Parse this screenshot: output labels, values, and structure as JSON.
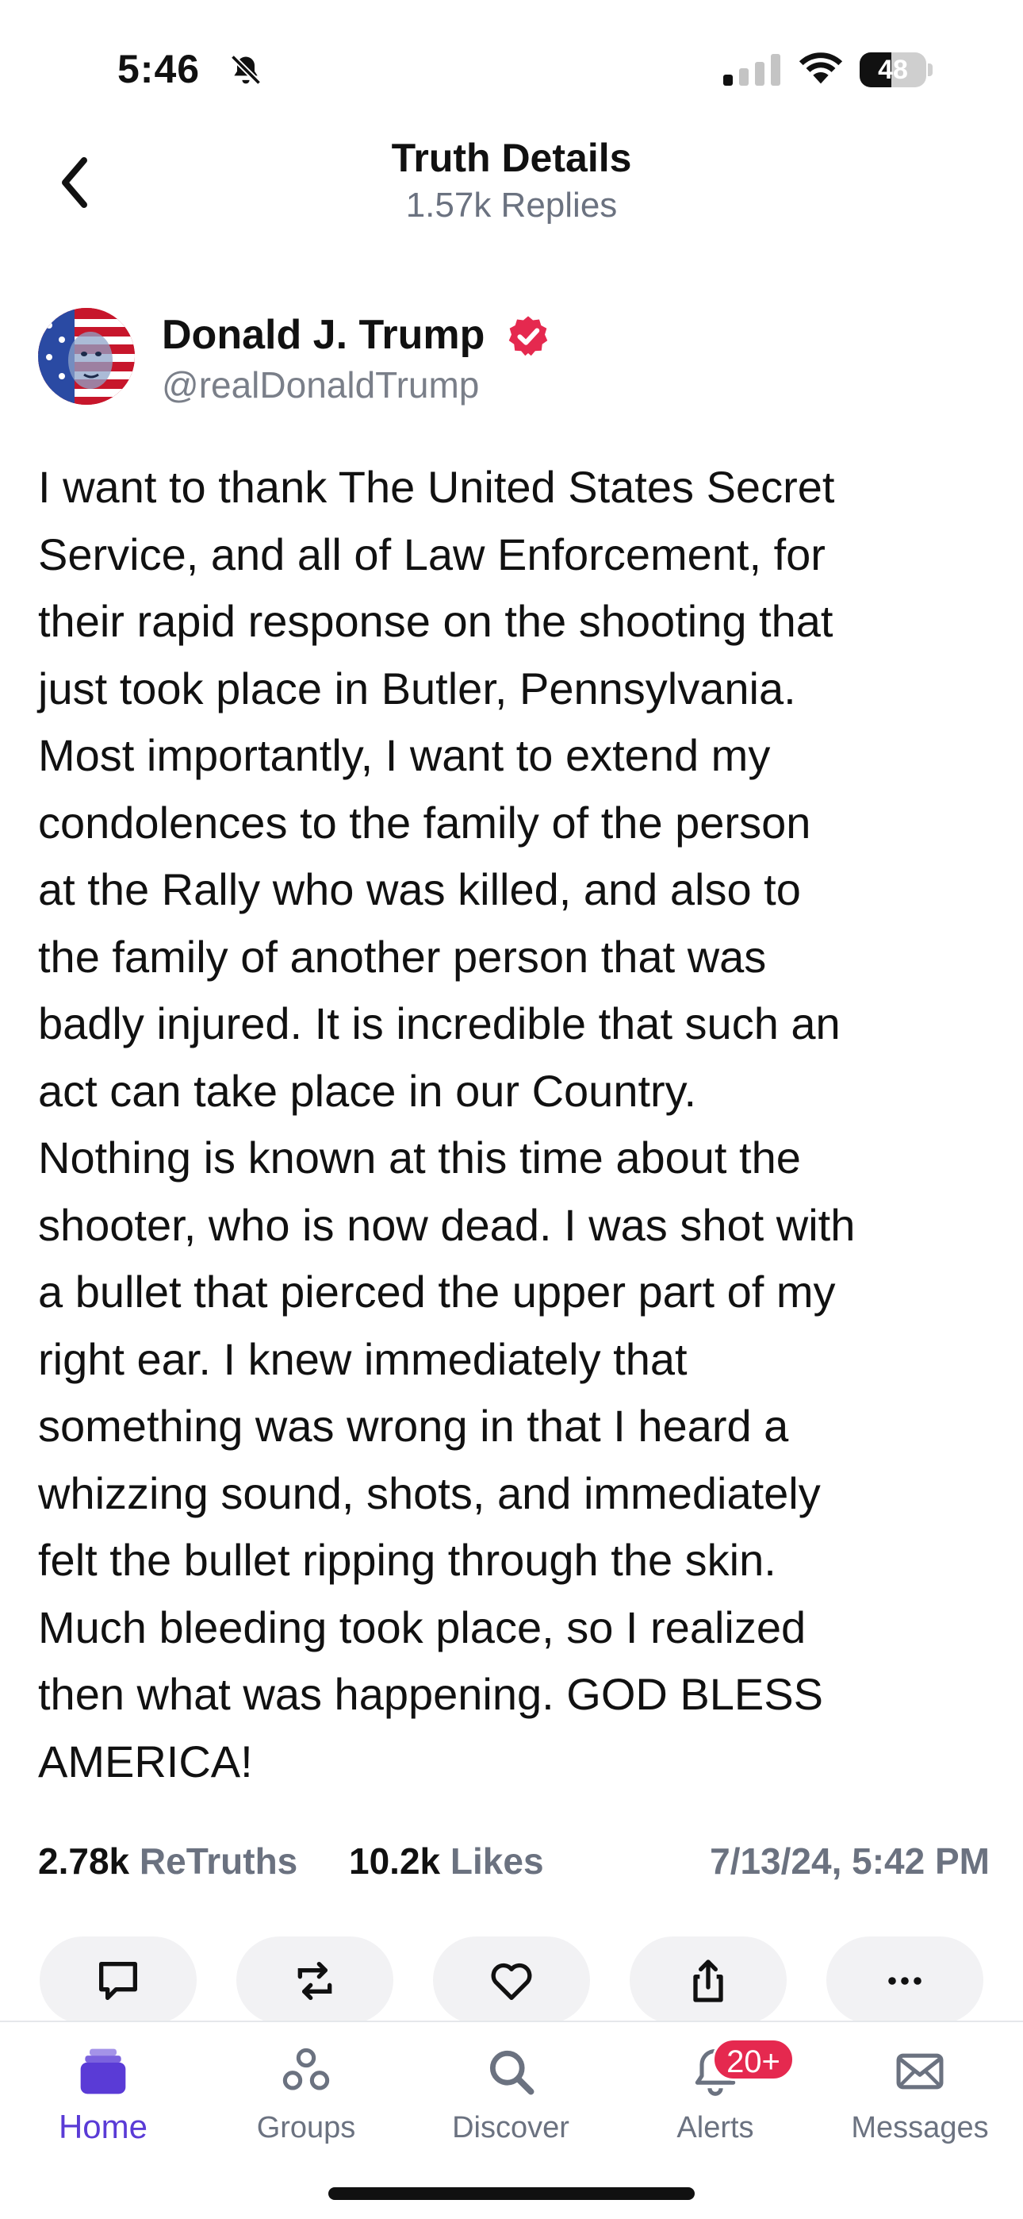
{
  "status_bar": {
    "time": "5:46",
    "battery": "48",
    "battery_level": 0.48,
    "icons": [
      "bell-slash-icon",
      "cellular-signal-icon",
      "wifi-icon",
      "battery-icon"
    ]
  },
  "header": {
    "title": "Truth Details",
    "subtitle": "1.57k Replies",
    "back_icon": "chevron-left-icon"
  },
  "post": {
    "author_name": "Donald J. Trump",
    "author_handle": "@realDonaldTrump",
    "verified_color": "#e5294f",
    "body": "I want to thank The United States Secret\nService, and all of Law Enforcement, for\ntheir rapid response on the shooting that\njust took place in Butler, Pennsylvania.\nMost importantly, I want to extend my\ncondolences to the family of the person\nat the Rally who was killed, and also to\nthe family of another person that was\nbadly injured. It is incredible that such an\nact can take place in our Country.\nNothing is known at this time about the\nshooter, who is now dead. I was shot with\na bullet that pierced the upper part of my\nright ear. I knew immediately that\nsomething was wrong in that I heard a\nwhizzing sound, shots, and immediately\nfelt the bullet ripping through the skin.\nMuch bleeding took place, so I realized\nthen what was happening. GOD BLESS\nAMERICA!",
    "retruths_count": "2.78k",
    "retruths_label": "ReTruths",
    "likes_count": "10.2k",
    "likes_label": "Likes",
    "timestamp": "7/13/24, 5:42 PM"
  },
  "actions": [
    {
      "icon": "reply-icon"
    },
    {
      "icon": "retruth-icon"
    },
    {
      "icon": "heart-icon"
    },
    {
      "icon": "share-icon"
    },
    {
      "icon": "more-icon"
    }
  ],
  "tab_bar": {
    "accent_color": "#5a3bd6",
    "tabs": [
      {
        "label": "Home",
        "icon": "home-icon",
        "active": true
      },
      {
        "label": "Groups",
        "icon": "groups-icon"
      },
      {
        "label": "Discover",
        "icon": "search-icon"
      },
      {
        "label": "Alerts",
        "icon": "bell-icon",
        "badge": "20+"
      },
      {
        "label": "Messages",
        "icon": "envelope-icon"
      }
    ]
  }
}
